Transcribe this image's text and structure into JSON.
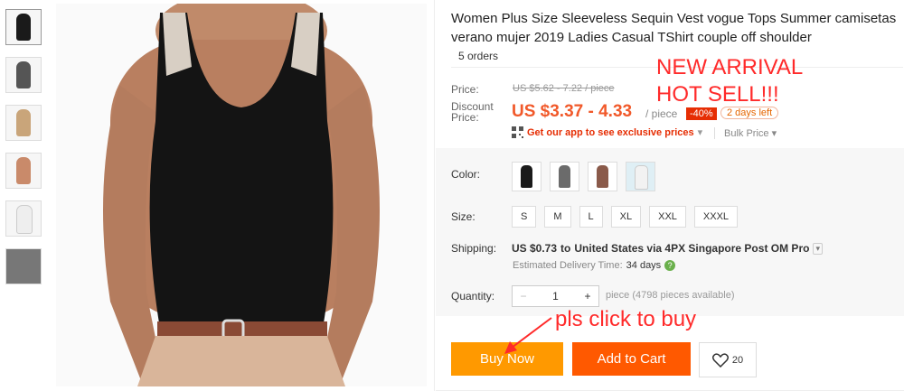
{
  "thumbnails": [
    {
      "color": "#1a1a1a"
    },
    {
      "color": "#555555"
    },
    {
      "color": "#c9a57a"
    },
    {
      "color": "#c98a6a"
    },
    {
      "color": "#eeeeee"
    },
    {
      "color": "#777777"
    }
  ],
  "product": {
    "title": "Women Plus Size Sleeveless Sequin Vest vogue Tops Summer camisetas verano mujer 2019 Ladies Casual TShirt couple off shoulder",
    "orders": "5 orders"
  },
  "price": {
    "label": "Price:",
    "original": "US $5.62 - 7.22 / piece",
    "discount_label_1": "Discount",
    "discount_label_2": "Price:",
    "current": "US $3.37 - 4.33",
    "unit": "/ piece",
    "discount_badge": "-40%",
    "days_left": "2 days left",
    "app_promo": "Get our app to see exclusive prices",
    "bulk": "Bulk Price",
    "accent": "#f1592a"
  },
  "color": {
    "label": "Color:",
    "options": [
      {
        "color": "#1a1a1a"
      },
      {
        "color": "#6b6b6b"
      },
      {
        "color": "#8a5a4a"
      },
      {
        "color": "#f2f2f2"
      }
    ]
  },
  "size": {
    "label": "Size:",
    "options": [
      "S",
      "M",
      "L",
      "XL",
      "XXL",
      "XXXL"
    ]
  },
  "shipping": {
    "label": "Shipping:",
    "cost": "US $0.73",
    "to": "to",
    "destination": "United States via 4PX Singapore Post OM Pro",
    "estimated_label": "Estimated Delivery Time:",
    "estimated_value": "34 days"
  },
  "quantity": {
    "label": "Quantity:",
    "minus": "−",
    "value": "1",
    "plus": "+",
    "available": "piece (4798 pieces available)"
  },
  "actions": {
    "buy_now": "Buy Now",
    "add_to_cart": "Add to Cart",
    "wishlist_count": "20"
  },
  "annotations": {
    "line1": "NEW ARRIVAL",
    "line2": "HOT SELL!!!",
    "click": "pls click to buy",
    "color": "#ff2a2a"
  }
}
